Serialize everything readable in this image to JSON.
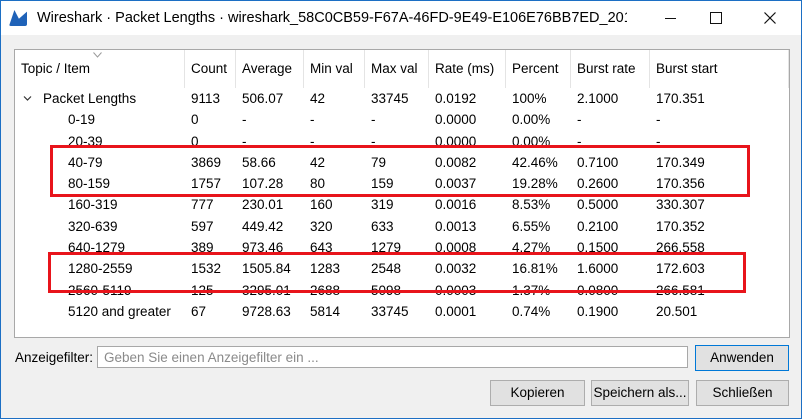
{
  "window": {
    "title": "Wireshark · Packet Lengths · wireshark_58C0CB59-F67A-46FD-9E49-E106E76BB7ED_201..."
  },
  "table": {
    "columns": [
      "Topic / Item",
      "Count",
      "Average",
      "Min val",
      "Max val",
      "Rate (ms)",
      "Percent",
      "Burst rate",
      "Burst start"
    ],
    "rows": [
      {
        "level": 0,
        "expanded": true,
        "cells": [
          "Packet Lengths",
          "9113",
          "506.07",
          "42",
          "33745",
          "0.0192",
          "100%",
          "2.1000",
          "170.351"
        ]
      },
      {
        "level": 1,
        "cells": [
          "0-19",
          "0",
          "-",
          "-",
          "-",
          "0.0000",
          "0.00%",
          "-",
          "-"
        ]
      },
      {
        "level": 1,
        "cells": [
          "20-39",
          "0",
          "-",
          "-",
          "-",
          "0.0000",
          "0.00%",
          "-",
          "-"
        ]
      },
      {
        "level": 1,
        "cells": [
          "40-79",
          "3869",
          "58.66",
          "42",
          "79",
          "0.0082",
          "42.46%",
          "0.7100",
          "170.349"
        ]
      },
      {
        "level": 1,
        "cells": [
          "80-159",
          "1757",
          "107.28",
          "80",
          "159",
          "0.0037",
          "19.28%",
          "0.2600",
          "170.356"
        ]
      },
      {
        "level": 1,
        "cells": [
          "160-319",
          "777",
          "230.01",
          "160",
          "319",
          "0.0016",
          "8.53%",
          "0.5000",
          "330.307"
        ]
      },
      {
        "level": 1,
        "cells": [
          "320-639",
          "597",
          "449.42",
          "320",
          "633",
          "0.0013",
          "6.55%",
          "0.2100",
          "170.352"
        ]
      },
      {
        "level": 1,
        "cells": [
          "640-1279",
          "389",
          "973.46",
          "643",
          "1279",
          "0.0008",
          "4.27%",
          "0.1500",
          "266.558"
        ]
      },
      {
        "level": 1,
        "cells": [
          "1280-2559",
          "1532",
          "1505.84",
          "1283",
          "2548",
          "0.0032",
          "16.81%",
          "1.6000",
          "172.603"
        ]
      },
      {
        "level": 1,
        "cells": [
          "2560-5119",
          "125",
          "3295.01",
          "2688",
          "5098",
          "0.0003",
          "1.37%",
          "0.0800",
          "266.581"
        ]
      },
      {
        "level": 1,
        "cells": [
          "5120 and greater",
          "67",
          "9728.63",
          "5814",
          "33745",
          "0.0001",
          "0.74%",
          "0.1900",
          "20.501"
        ]
      }
    ]
  },
  "filter": {
    "label": "Anzeigefilter:",
    "placeholder": "Geben Sie einen Anzeigefilter ein ...",
    "value": ""
  },
  "buttons": {
    "apply": "Anwenden",
    "copy": "Kopieren",
    "save": "Speichern als...",
    "close": "Schließen"
  },
  "icons": {
    "app": "wireshark-fin-icon",
    "minimize": "minimize-icon",
    "maximize": "maximize-icon",
    "close": "close-icon",
    "expander": "chevron-down-icon",
    "sort": "sort-indicator-icon"
  },
  "colors": {
    "highlight_box": "#e8141b",
    "window_border": "#1c6fc4",
    "accent": "#0078d7"
  }
}
